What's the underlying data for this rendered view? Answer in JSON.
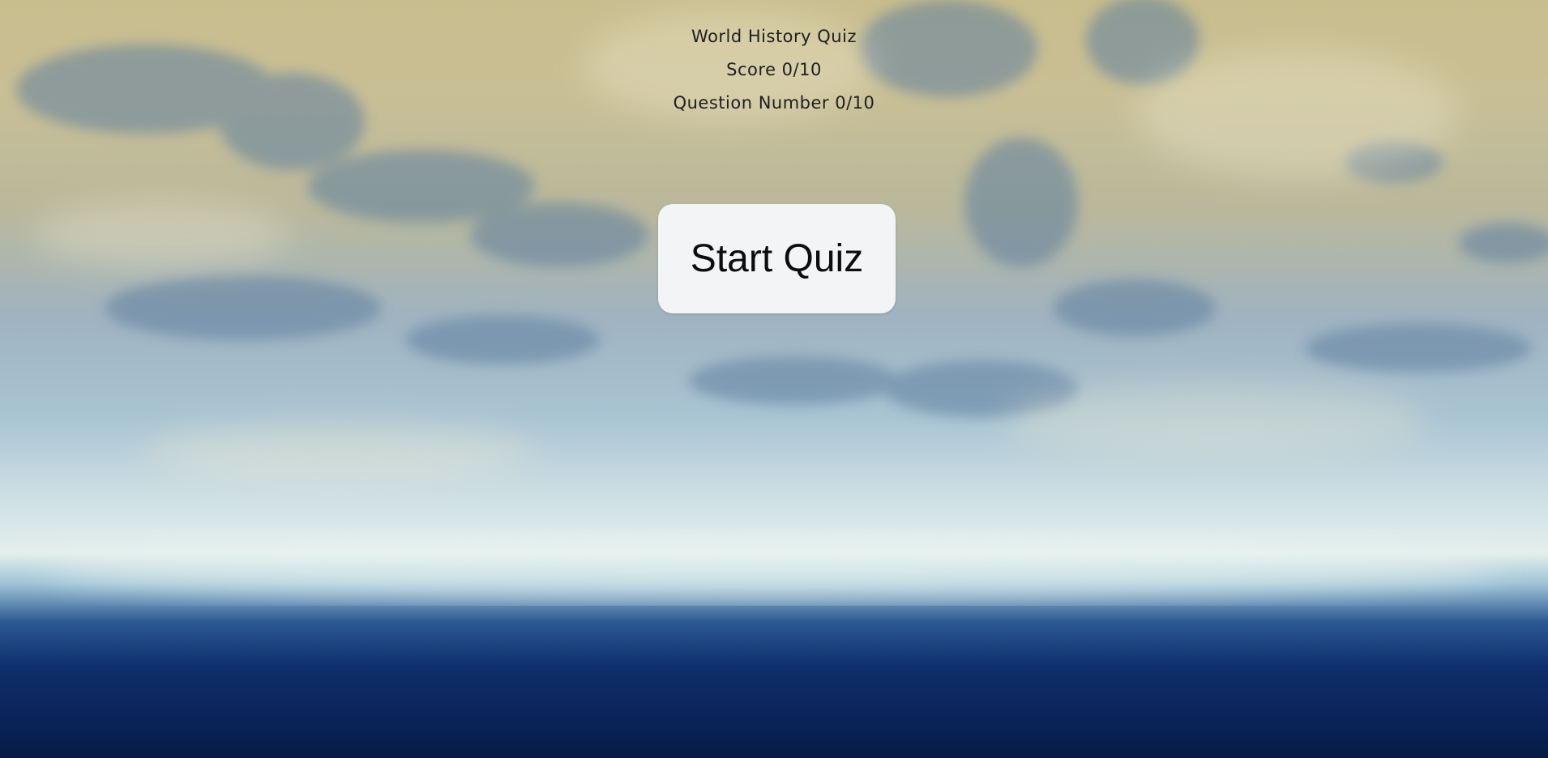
{
  "quiz": {
    "title": "World History Quiz",
    "score": "Score 0/10",
    "question_number": "Question Number 0/10"
  },
  "start_button": {
    "label": "Start Quiz"
  },
  "colors": {
    "button_background": "#f3f4f5",
    "text": "#1e1e1e",
    "ocean_dark": "#071b47",
    "desert_tan": "#c8bd8c"
  }
}
